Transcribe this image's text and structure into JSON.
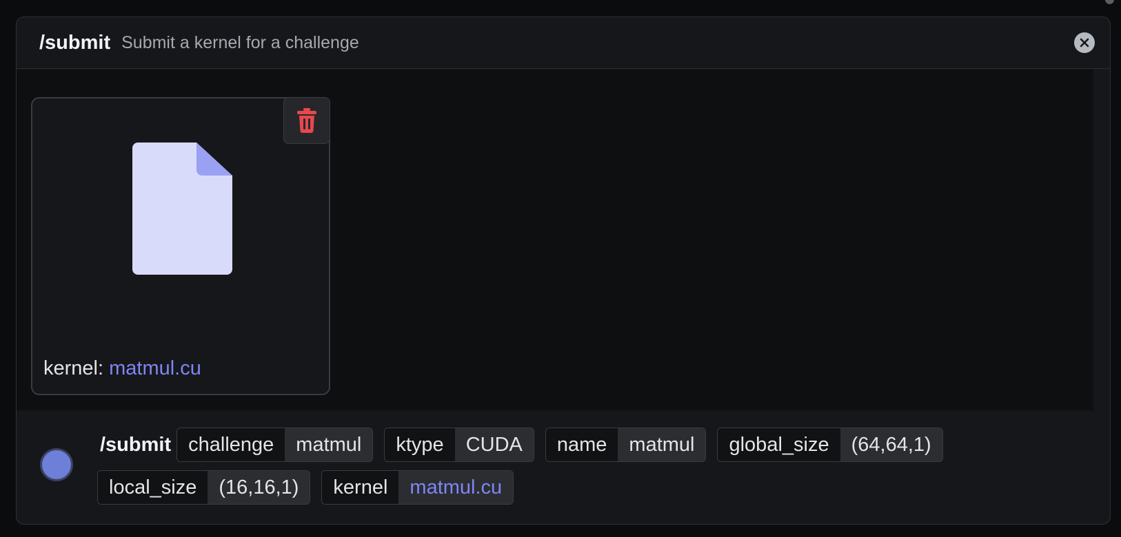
{
  "command": {
    "name": "/submit",
    "description": "Submit a kernel for a challenge"
  },
  "attachment": {
    "label_prefix": "kernel:",
    "filename": "matmul.cu",
    "icon": "file-icon",
    "delete_icon": "trash-icon"
  },
  "input": {
    "command": "/submit",
    "options": [
      {
        "key": "challenge",
        "value": "matmul"
      },
      {
        "key": "ktype",
        "value": "CUDA"
      },
      {
        "key": "name",
        "value": "matmul"
      },
      {
        "key": "global_size",
        "value": "(64,64,1)"
      },
      {
        "key": "local_size",
        "value": "(16,16,1)"
      },
      {
        "key": "kernel",
        "value": "matmul.cu"
      }
    ]
  },
  "colors": {
    "accent": "#7f86f4",
    "danger": "#e5484d",
    "avatar": "#6d7fd6"
  }
}
